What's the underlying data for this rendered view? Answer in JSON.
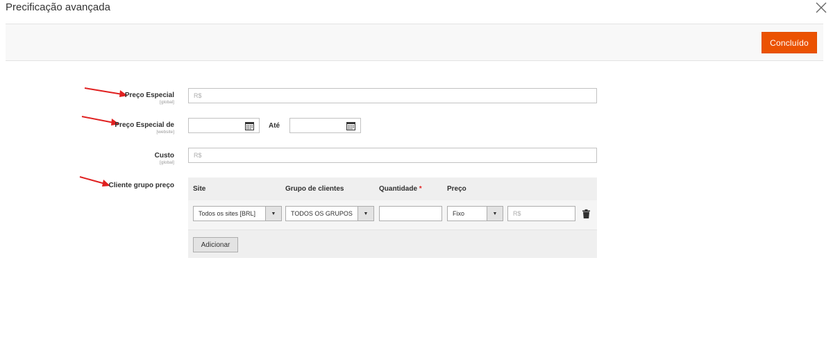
{
  "modal": {
    "title": "Precificação avançada",
    "close_icon": "close-icon"
  },
  "toolbar": {
    "done_label": "Concluído",
    "accent_color": "#eb5202"
  },
  "fields": {
    "special_price": {
      "label": "Preço Especial",
      "scope": "[global]",
      "placeholder": "R$"
    },
    "special_from": {
      "label": "Preço Especial de",
      "scope": "[website]",
      "until_label": "Até",
      "icon": "calendar-icon"
    },
    "cost": {
      "label": "Custo",
      "scope": "[global]",
      "placeholder": "R$"
    },
    "tier_price": {
      "label": "Cliente grupo preço"
    }
  },
  "tier_table": {
    "headers": {
      "site": "Site",
      "group": "Grupo de clientes",
      "qty": "Quantidade",
      "qty_required": "*",
      "price": "Preço"
    },
    "row": {
      "site": "Todos os sites [BRL]",
      "group": "TODOS OS GRUPOS",
      "qty": "",
      "price_type": "Fixo",
      "price_placeholder": "R$",
      "delete_icon": "trash-icon"
    },
    "add_label": "Adicionar"
  },
  "annotation_color": "#e02020"
}
